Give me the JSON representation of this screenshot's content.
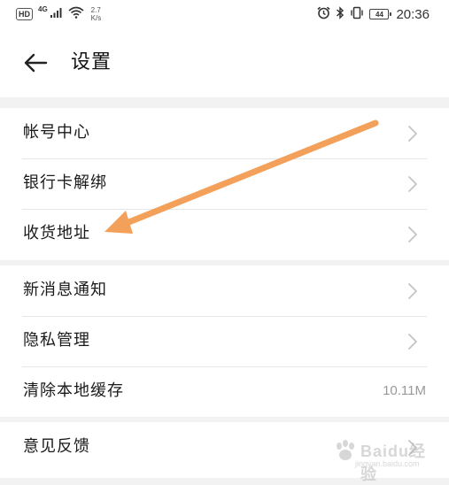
{
  "status_bar": {
    "hd": "HD",
    "network": "4G",
    "speed_value": "2.7",
    "speed_unit": "K/s",
    "battery": "44",
    "time": "20:36"
  },
  "header": {
    "title": "设置"
  },
  "groups": [
    {
      "items": [
        {
          "label": "帐号中心",
          "chevron": true
        },
        {
          "label": "银行卡解绑",
          "chevron": true
        },
        {
          "label": "收货地址",
          "chevron": true
        }
      ]
    },
    {
      "items": [
        {
          "label": "新消息通知",
          "chevron": true
        },
        {
          "label": "隐私管理",
          "chevron": true
        },
        {
          "label": "清除本地缓存",
          "value": "10.11M"
        }
      ]
    },
    {
      "items": [
        {
          "label": "意见反馈",
          "chevron": true
        }
      ]
    }
  ],
  "annotation": {
    "color": "#f2a05a",
    "points_to": "收货地址"
  },
  "watermark": {
    "text": "Baidu经验",
    "sub": "jingyan.baidu.com"
  },
  "icons": [
    "back-arrow-icon",
    "cellular-signal-icon",
    "wifi-icon",
    "alarm-icon",
    "bluetooth-icon",
    "vibrate-icon",
    "battery-icon",
    "chevron-right-icon",
    "baidu-paw-icon"
  ]
}
